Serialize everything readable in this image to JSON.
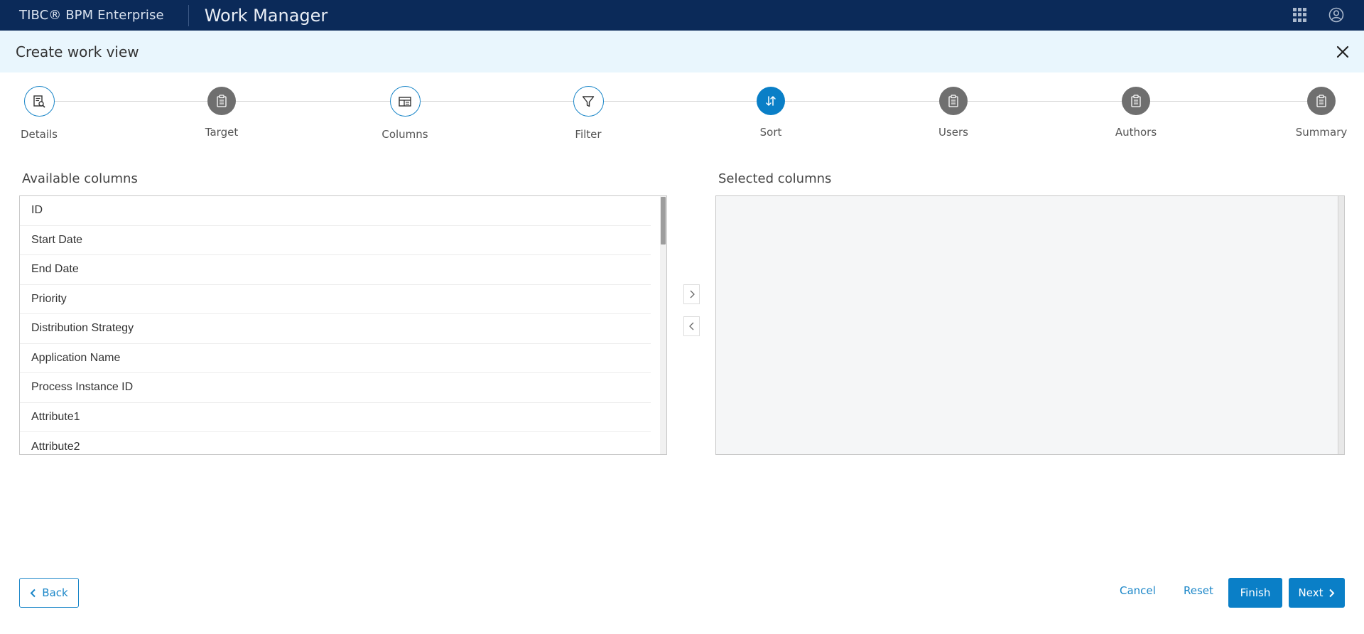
{
  "topbar": {
    "brand": "TIBC® BPM Enterprise",
    "app_title": "Work Manager",
    "icons": [
      "apps-grid-icon",
      "user-account-icon"
    ]
  },
  "header": {
    "title": "Create work view",
    "close_icon": "close-icon"
  },
  "stepper": {
    "steps": [
      {
        "label": "Details",
        "state": "completed",
        "icon": "document-search-icon"
      },
      {
        "label": "Target",
        "state": "pending",
        "icon": "clipboard-icon"
      },
      {
        "label": "Columns",
        "state": "completed",
        "icon": "table-columns-icon"
      },
      {
        "label": "Filter",
        "state": "completed",
        "icon": "filter-icon"
      },
      {
        "label": "Sort",
        "state": "active",
        "icon": "sort-arrows-icon"
      },
      {
        "label": "Users",
        "state": "pending",
        "icon": "clipboard-icon"
      },
      {
        "label": "Authors",
        "state": "pending",
        "icon": "clipboard-icon"
      },
      {
        "label": "Summary",
        "state": "pending",
        "icon": "clipboard-icon"
      }
    ],
    "colors": {
      "active": "#0a7fc7",
      "outline": "#1a86c8",
      "pending": "#6f6f6f"
    }
  },
  "columns": {
    "available_label": "Available columns",
    "selected_label": "Selected columns",
    "available": [
      "ID",
      "Start Date",
      "End Date",
      "Priority",
      "Distribution Strategy",
      "Application Name",
      "Process Instance ID",
      "Attribute1",
      "Attribute2"
    ],
    "selected": []
  },
  "footer": {
    "back_label": "Back",
    "cancel_label": "Cancel",
    "reset_label": "Reset",
    "finish_label": "Finish",
    "next_label": "Next"
  }
}
